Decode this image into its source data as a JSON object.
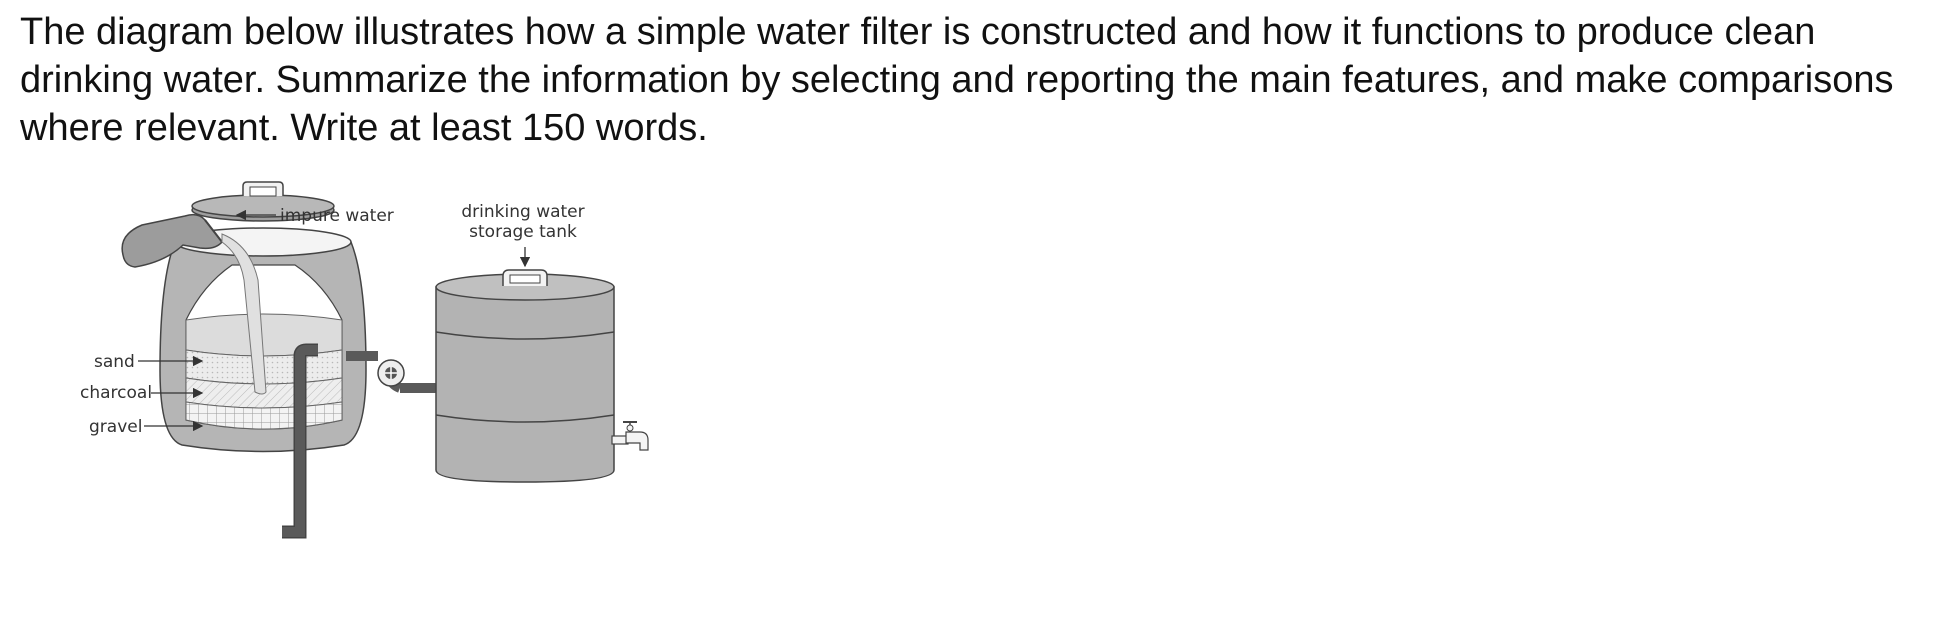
{
  "question": {
    "text": "The diagram below illustrates how a simple water filter is constructed and how it functions to produce clean drinking water. Summarize the information by selecting and reporting the main features, and make comparisons where relevant. Write at least 150 words."
  },
  "diagram": {
    "labels": {
      "impure_water": "impure water",
      "storage_tank_line1": "drinking water",
      "storage_tank_line2": "storage tank",
      "sand": "sand",
      "charcoal": "charcoal",
      "gravel": "gravel"
    }
  }
}
